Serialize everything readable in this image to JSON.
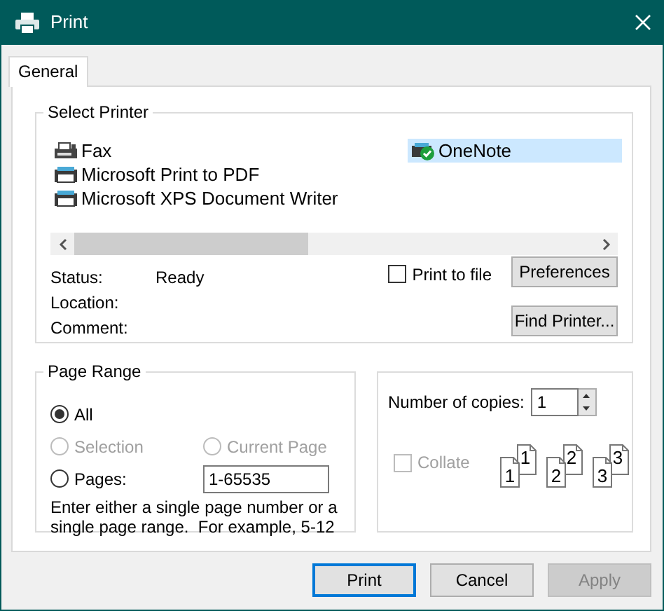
{
  "window": {
    "title": "Print"
  },
  "tabs": [
    {
      "label": "General",
      "selected": true
    }
  ],
  "select_printer": {
    "title": "Select Printer",
    "printers": [
      {
        "name": "Fax",
        "kind": "fax",
        "selected": false
      },
      {
        "name": "Microsoft Print to PDF",
        "kind": "printer",
        "selected": false
      },
      {
        "name": "Microsoft XPS Document Writer",
        "kind": "printer",
        "selected": false
      },
      {
        "name": "OneNote",
        "kind": "default",
        "selected": true
      }
    ],
    "info": [
      {
        "label": "Status:",
        "value": "Ready"
      },
      {
        "label": "Location:"
      },
      {
        "label": "Comment:"
      }
    ],
    "print_to_file": {
      "label": "Print to file",
      "checked": false
    },
    "buttons": [
      "Preferences",
      "Find Printer..."
    ]
  },
  "page_range": {
    "title": "Page Range",
    "options": [
      {
        "label": "All",
        "selected": true,
        "disabled": false
      },
      {
        "label": "Selection",
        "selected": false,
        "disabled": true
      },
      {
        "label": "Current Page",
        "selected": false,
        "disabled": true
      },
      {
        "label": "Pages:",
        "selected": false,
        "disabled": false
      }
    ],
    "pages_value": "1-65535",
    "hint": "Enter either a single page number or a single page range.  For example, 5-12"
  },
  "copies": {
    "label": "Number of copies:",
    "value": "1",
    "collate": {
      "label": "Collate",
      "checked": false,
      "disabled": true
    },
    "collate_sets": [
      {
        "front": "1",
        "back": "1"
      },
      {
        "front": "2",
        "back": "2"
      },
      {
        "front": "3",
        "back": "3"
      }
    ]
  },
  "buttons": [
    {
      "label": "Print",
      "default": true,
      "disabled": false
    },
    {
      "label": "Cancel",
      "default": false,
      "disabled": false
    },
    {
      "label": "Apply",
      "default": false,
      "disabled": true
    }
  ]
}
